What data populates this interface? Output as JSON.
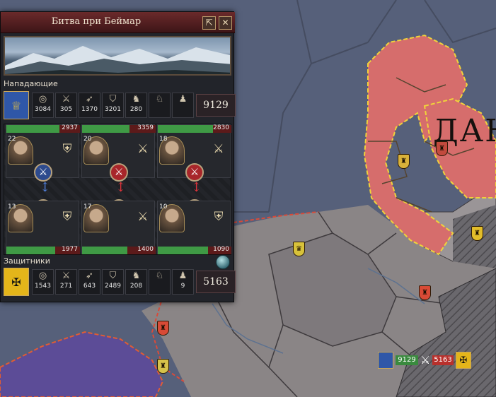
{
  "window": {
    "title": "Битва при Беймар",
    "close_label": "✕",
    "pin_label": "⇱"
  },
  "attackers": {
    "label": "Нападающие",
    "total": "9129",
    "coat_of_arms_icon": "crown-shield-icon",
    "coat_color": "#2f57a8",
    "units": [
      {
        "icon": "light-infantry-icon",
        "glyph": "◎",
        "value": "3084"
      },
      {
        "icon": "heavy-infantry-icon",
        "glyph": "⚔",
        "value": "305"
      },
      {
        "icon": "archers-icon",
        "glyph": "➶",
        "value": "1370"
      },
      {
        "icon": "pikemen-icon",
        "glyph": "⛉",
        "value": "3201"
      },
      {
        "icon": "light-cavalry-icon",
        "glyph": "♞",
        "value": "280"
      },
      {
        "icon": "heavy-cavalry-icon",
        "glyph": "♘",
        "value": ""
      },
      {
        "icon": "camels-icon",
        "glyph": "♟",
        "value": ""
      }
    ],
    "flanks": [
      {
        "name": "left",
        "hp": "2937",
        "hp_fraction": 0.72,
        "commander_skill": "22",
        "tactic_icon": "shield-tactic-icon"
      },
      {
        "name": "center",
        "hp": "3359",
        "hp_fraction": 0.64,
        "commander_skill": "20",
        "tactic_icon": "crossed-axes-tactic-icon"
      },
      {
        "name": "right",
        "hp": "2830",
        "hp_fraction": 0.75,
        "commander_skill": "18",
        "tactic_icon": "crossed-axes-tactic-icon"
      }
    ]
  },
  "defenders": {
    "label": "Защитники",
    "total": "5163",
    "coat_of_arms_icon": "black-eagle-shield-icon",
    "coat_color": "#e4b51a",
    "units": [
      {
        "icon": "light-infantry-icon",
        "glyph": "◎",
        "value": "1543"
      },
      {
        "icon": "heavy-infantry-icon",
        "glyph": "⚔",
        "value": "271"
      },
      {
        "icon": "archers-icon",
        "glyph": "➶",
        "value": "643"
      },
      {
        "icon": "pikemen-icon",
        "glyph": "⛉",
        "value": "2489"
      },
      {
        "icon": "light-cavalry-icon",
        "glyph": "♞",
        "value": "208"
      },
      {
        "icon": "heavy-cavalry-icon",
        "glyph": "♘",
        "value": ""
      },
      {
        "icon": "camels-icon",
        "glyph": "♟",
        "value": "9"
      }
    ],
    "flanks": [
      {
        "name": "left",
        "hp": "1977",
        "hp_fraction": 0.66,
        "commander_skill": "13",
        "tactic_icon": "shield-tactic-icon"
      },
      {
        "name": "center",
        "hp": "1400",
        "hp_fraction": 0.62,
        "commander_skill": "17",
        "tactic_icon": "crossed-axes-tactic-icon"
      },
      {
        "name": "right",
        "hp": "1090",
        "hp_fraction": 0.68,
        "commander_skill": "10",
        "tactic_icon": "shield-tactic-icon"
      }
    ]
  },
  "map": {
    "region_label": "ДАН",
    "mini_battle": {
      "attacker_total": "9129",
      "defender_total": "5163"
    },
    "colors": {
      "sea": "#5a6478",
      "denmark": "#d86e6c",
      "germany": "#8f8a8c",
      "purple_realm": "#5f4e99",
      "hatched": "#6e6c70"
    }
  }
}
